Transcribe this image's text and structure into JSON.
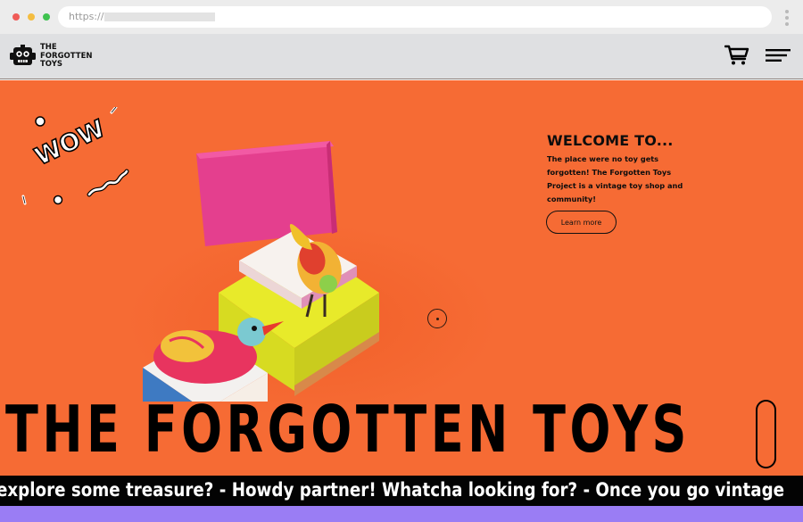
{
  "browser": {
    "url_scheme": "https://"
  },
  "header": {
    "logo_lines": [
      "THE",
      "FORGOTTEN",
      "TOYS"
    ],
    "cart_icon": "shopping-cart-icon",
    "menu_icon": "menu-icon"
  },
  "hero": {
    "doodle_text": "WOW",
    "welcome_title": "WELCOME TO...",
    "welcome_text": "The place were no toy gets forgotten! The Forgotten Toys Project is a vintage toy shop and community!",
    "learn_more_label": "Learn more",
    "big_title": "THE FORGOTTEN TOYS"
  },
  "marquee": {
    "text": "explore some treasure? - Howdy partner! Whatcha looking for? - Once you go vintage"
  },
  "colors": {
    "hero_background": "#f66b34",
    "marquee_background": "#030303",
    "bottom_band": "#9a7df4",
    "header_background": "#dfe0e2"
  }
}
